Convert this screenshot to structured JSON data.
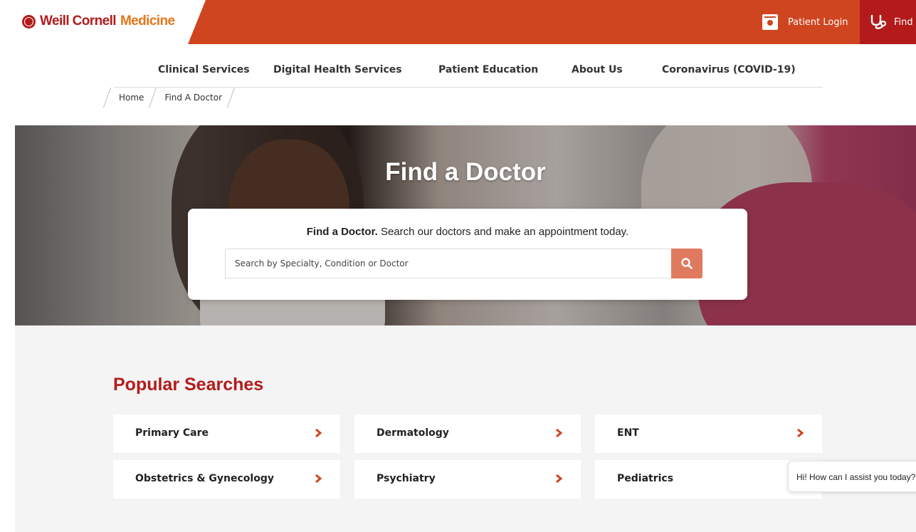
{
  "header": {
    "logo_part1": "Weill Cornell",
    "logo_part2": "Medicine",
    "patient_login": "Patient Login",
    "find_label": "Find",
    "colors": {
      "brand_red": "#b31b1b",
      "brand_orange": "#cf4520",
      "accent_orange": "#e7751d"
    }
  },
  "nav": {
    "items": [
      {
        "label": "Clinical Services"
      },
      {
        "label": "Digital Health Services"
      },
      {
        "label": "Patient Education"
      },
      {
        "label": "About Us"
      },
      {
        "label": "Coronavirus (COVID-19)"
      }
    ]
  },
  "breadcrumb": {
    "items": [
      {
        "label": "Home"
      },
      {
        "label": "Find A Doctor"
      }
    ]
  },
  "hero": {
    "title": "Find a Doctor",
    "search": {
      "lead_bold": "Find a Doctor.",
      "lead_rest": " Search our doctors and make an appointment today.",
      "placeholder": "Search by Specialty, Condition or Doctor",
      "button_icon": "search-icon"
    }
  },
  "popular": {
    "title": "Popular Searches",
    "items": [
      {
        "label": "Primary Care"
      },
      {
        "label": "Dermatology"
      },
      {
        "label": "ENT"
      },
      {
        "label": "Obstetrics & Gynecology"
      },
      {
        "label": "Psychiatry"
      },
      {
        "label": "Pediatrics"
      }
    ],
    "chevron_icon": "chevron-right-icon"
  },
  "chat": {
    "message": "Hi! How can I assist you today?"
  }
}
